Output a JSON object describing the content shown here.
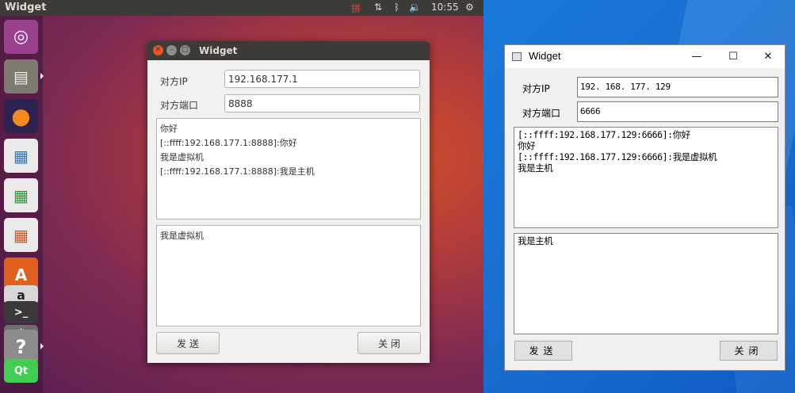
{
  "ubuntu": {
    "topbar": {
      "title": "Widget",
      "input_method_label": "拼",
      "network_icon": "network-updown-icon",
      "bluetooth_icon": "bluetooth-icon",
      "volume_icon": "volume-icon",
      "time": "10:55",
      "settings_icon": "gear-icon"
    },
    "launcher": {
      "items": [
        {
          "name": "ubuntu-logo",
          "glyph": "◉",
          "bg": "#b04a9a"
        },
        {
          "name": "files",
          "glyph": "▤",
          "bg": "#8a8a80"
        },
        {
          "name": "firefox",
          "glyph": "●",
          "bg": "#e8741c"
        },
        {
          "name": "writer",
          "glyph": "▦",
          "bg": "#2f7bc2"
        },
        {
          "name": "calc",
          "glyph": "▦",
          "bg": "#2f9a3a"
        },
        {
          "name": "impress",
          "glyph": "▦",
          "bg": "#d2561d"
        },
        {
          "name": "software-center",
          "glyph": "A",
          "bg": "#e0611e"
        },
        {
          "name": "amazon",
          "glyph": "a",
          "bg": "#c9c9c9"
        },
        {
          "name": "terminal",
          "glyph": ">_",
          "bg": "#3a3a3a"
        },
        {
          "name": "help",
          "glyph": "?",
          "bg": "#8a8a8a"
        },
        {
          "name": "qt-creator",
          "glyph": "Qt",
          "bg": "#41cd52"
        }
      ]
    },
    "window": {
      "title": "Widget",
      "peer_ip_label": "对方IP",
      "peer_ip_value": "192.168.177.1",
      "peer_port_label": "对方端口",
      "peer_port_value": "8888",
      "received_lines": [
        "你好",
        "[::ffff:192.168.177.1:8888]:你好",
        "我是虚拟机",
        "[::ffff:192.168.177.1:8888]:我是主机"
      ],
      "send_text": "我是虚拟机",
      "send_button": "发 送",
      "close_button": "关 闭"
    }
  },
  "windows": {
    "window": {
      "title": "Widget",
      "minimize_glyph": "—",
      "maximize_glyph": "☐",
      "close_glyph": "✕",
      "peer_ip_label": "对方IP",
      "peer_ip_value": "192. 168. 177. 129",
      "peer_port_label": "对方端口",
      "peer_port_value": "6666",
      "received_lines": [
        "[::ffff:192.168.177.129:6666]:你好",
        "你好",
        "[::ffff:192.168.177.129:6666]:我是虚拟机",
        "我是主机"
      ],
      "send_text": "我是主机",
      "send_button": "发送",
      "close_button": "关闭"
    }
  }
}
